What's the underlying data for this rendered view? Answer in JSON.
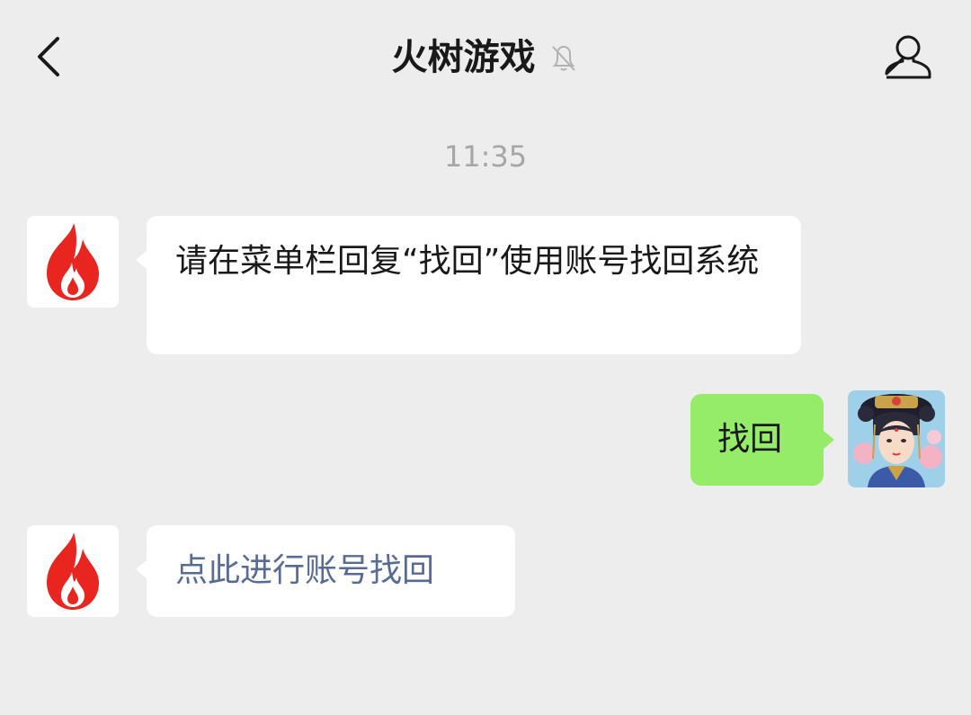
{
  "header": {
    "title": "火树游戏",
    "back_icon": "chevron-left-icon",
    "mute_icon": "bell-off-icon",
    "profile_icon": "person-icon"
  },
  "timestamp": "11:35",
  "messages": [
    {
      "sender": "official-account",
      "avatar_icon": "flame-logo",
      "text": "请在菜单栏回复“找回”使用账号找回系统"
    },
    {
      "sender": "me",
      "avatar_icon": "game-character-avatar",
      "text": "找回"
    },
    {
      "sender": "official-account",
      "avatar_icon": "flame-logo",
      "text": "点此进行账号找回"
    }
  ],
  "colors": {
    "background": "#ededed",
    "incoming_bubble": "#ffffff",
    "outgoing_bubble": "#95ec69",
    "link": "#576b95",
    "timestamp": "#a6a6a6",
    "brand_red": "#e8251f"
  }
}
